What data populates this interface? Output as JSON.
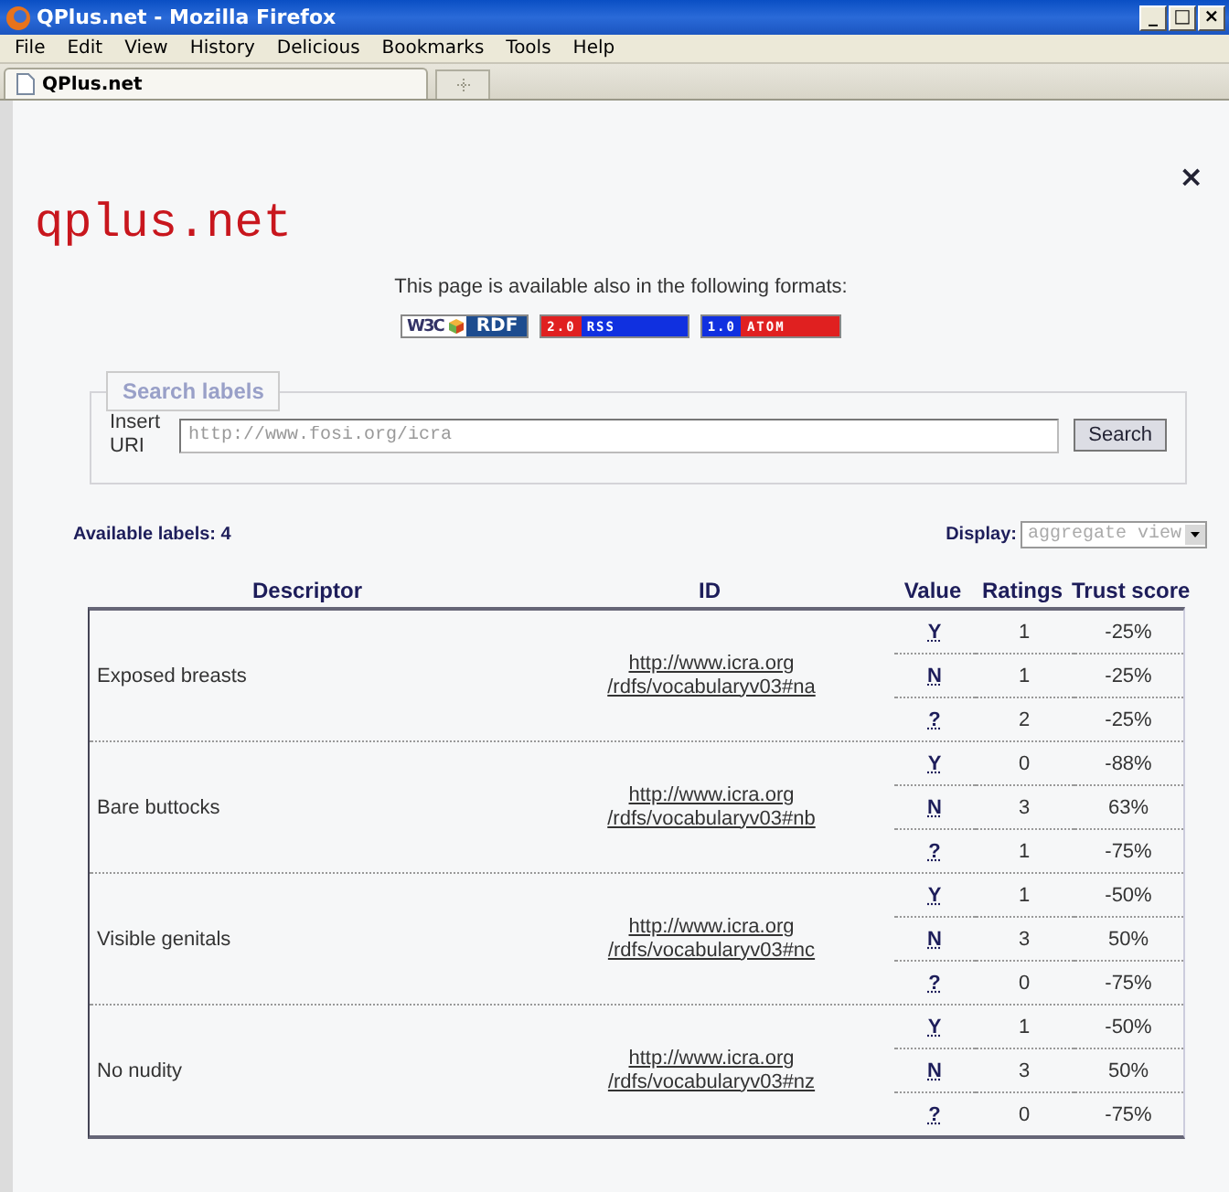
{
  "window": {
    "title": "QPlus.net - Mozilla Firefox",
    "controls": [
      "_",
      "□",
      "×"
    ]
  },
  "menu": [
    "File",
    "Edit",
    "View",
    "History",
    "Delicious",
    "Bookmarks",
    "Tools",
    "Help"
  ],
  "tabs": [
    {
      "label": "QPlus.net",
      "selected": true
    }
  ],
  "page": {
    "logo": "qplus.net",
    "close": "×",
    "formats_text": "This page is available also in the following formats:",
    "formats": [
      {
        "kind": "rdf",
        "parts": [
          "W3C",
          "RDF"
        ]
      },
      {
        "kind": "rss",
        "parts": [
          "2.0",
          "RSS"
        ]
      },
      {
        "kind": "atom",
        "parts": [
          "1.0",
          "ATOM"
        ]
      }
    ],
    "search": {
      "legend": "Search labels",
      "label": "Insert URI",
      "placeholder": "http://www.fosi.org/icra",
      "button": "Search"
    },
    "available": "Available labels: 4",
    "display_label": "Display:",
    "display_value": "aggregate view",
    "table": {
      "columns": [
        "Descriptor",
        "ID",
        "Value",
        "Ratings",
        "Trust score"
      ],
      "rows": [
        {
          "descriptor": "Exposed breasts",
          "id": [
            "http://www.icra.org",
            "/rdfs/vocabularyv03#na"
          ],
          "values": [
            {
              "value": "Y",
              "ratings": "1",
              "trust": "-25%"
            },
            {
              "value": "N",
              "ratings": "1",
              "trust": "-25%"
            },
            {
              "value": "?",
              "ratings": "2",
              "trust": "-25%"
            }
          ]
        },
        {
          "descriptor": "Bare buttocks",
          "id": [
            "http://www.icra.org",
            "/rdfs/vocabularyv03#nb"
          ],
          "values": [
            {
              "value": "Y",
              "ratings": "0",
              "trust": "-88%"
            },
            {
              "value": "N",
              "ratings": "3",
              "trust": "63%"
            },
            {
              "value": "?",
              "ratings": "1",
              "trust": "-75%"
            }
          ]
        },
        {
          "descriptor": "Visible genitals",
          "id": [
            "http://www.icra.org",
            "/rdfs/vocabularyv03#nc"
          ],
          "values": [
            {
              "value": "Y",
              "ratings": "1",
              "trust": "-50%"
            },
            {
              "value": "N",
              "ratings": "3",
              "trust": "50%"
            },
            {
              "value": "?",
              "ratings": "0",
              "trust": "-75%"
            }
          ]
        },
        {
          "descriptor": "No nudity",
          "id": [
            "http://www.icra.org",
            "/rdfs/vocabularyv03#nz"
          ],
          "values": [
            {
              "value": "Y",
              "ratings": "1",
              "trust": "-50%"
            },
            {
              "value": "N",
              "ratings": "3",
              "trust": "50%"
            },
            {
              "value": "?",
              "ratings": "0",
              "trust": "-75%"
            }
          ]
        }
      ]
    }
  }
}
